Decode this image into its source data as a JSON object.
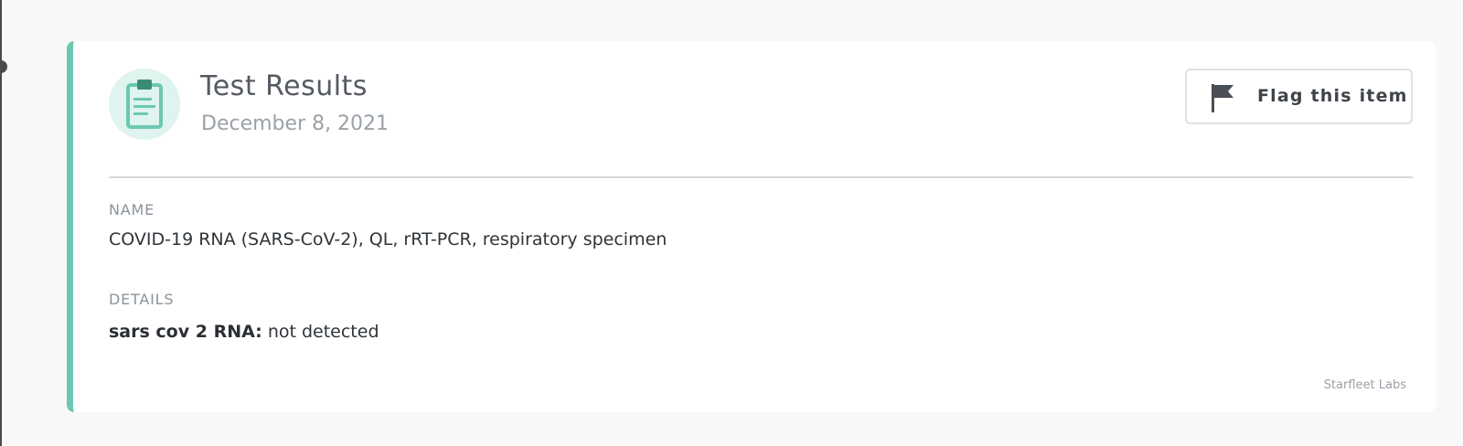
{
  "card": {
    "title": "Test Results",
    "date": "December 8, 2021",
    "flag_button_label": "Flag this item",
    "accent_color": "#6cc8b0",
    "icon": "clipboard-icon",
    "name_label": "NAME",
    "name_value": "COVID-19 RNA (SARS-CoV-2), QL, rRT-PCR, respiratory specimen",
    "details_label": "DETAILS",
    "details": [
      {
        "key": "sars cov 2 RNA:",
        "value": "not detected"
      }
    ],
    "source": "Starfleet Labs"
  }
}
